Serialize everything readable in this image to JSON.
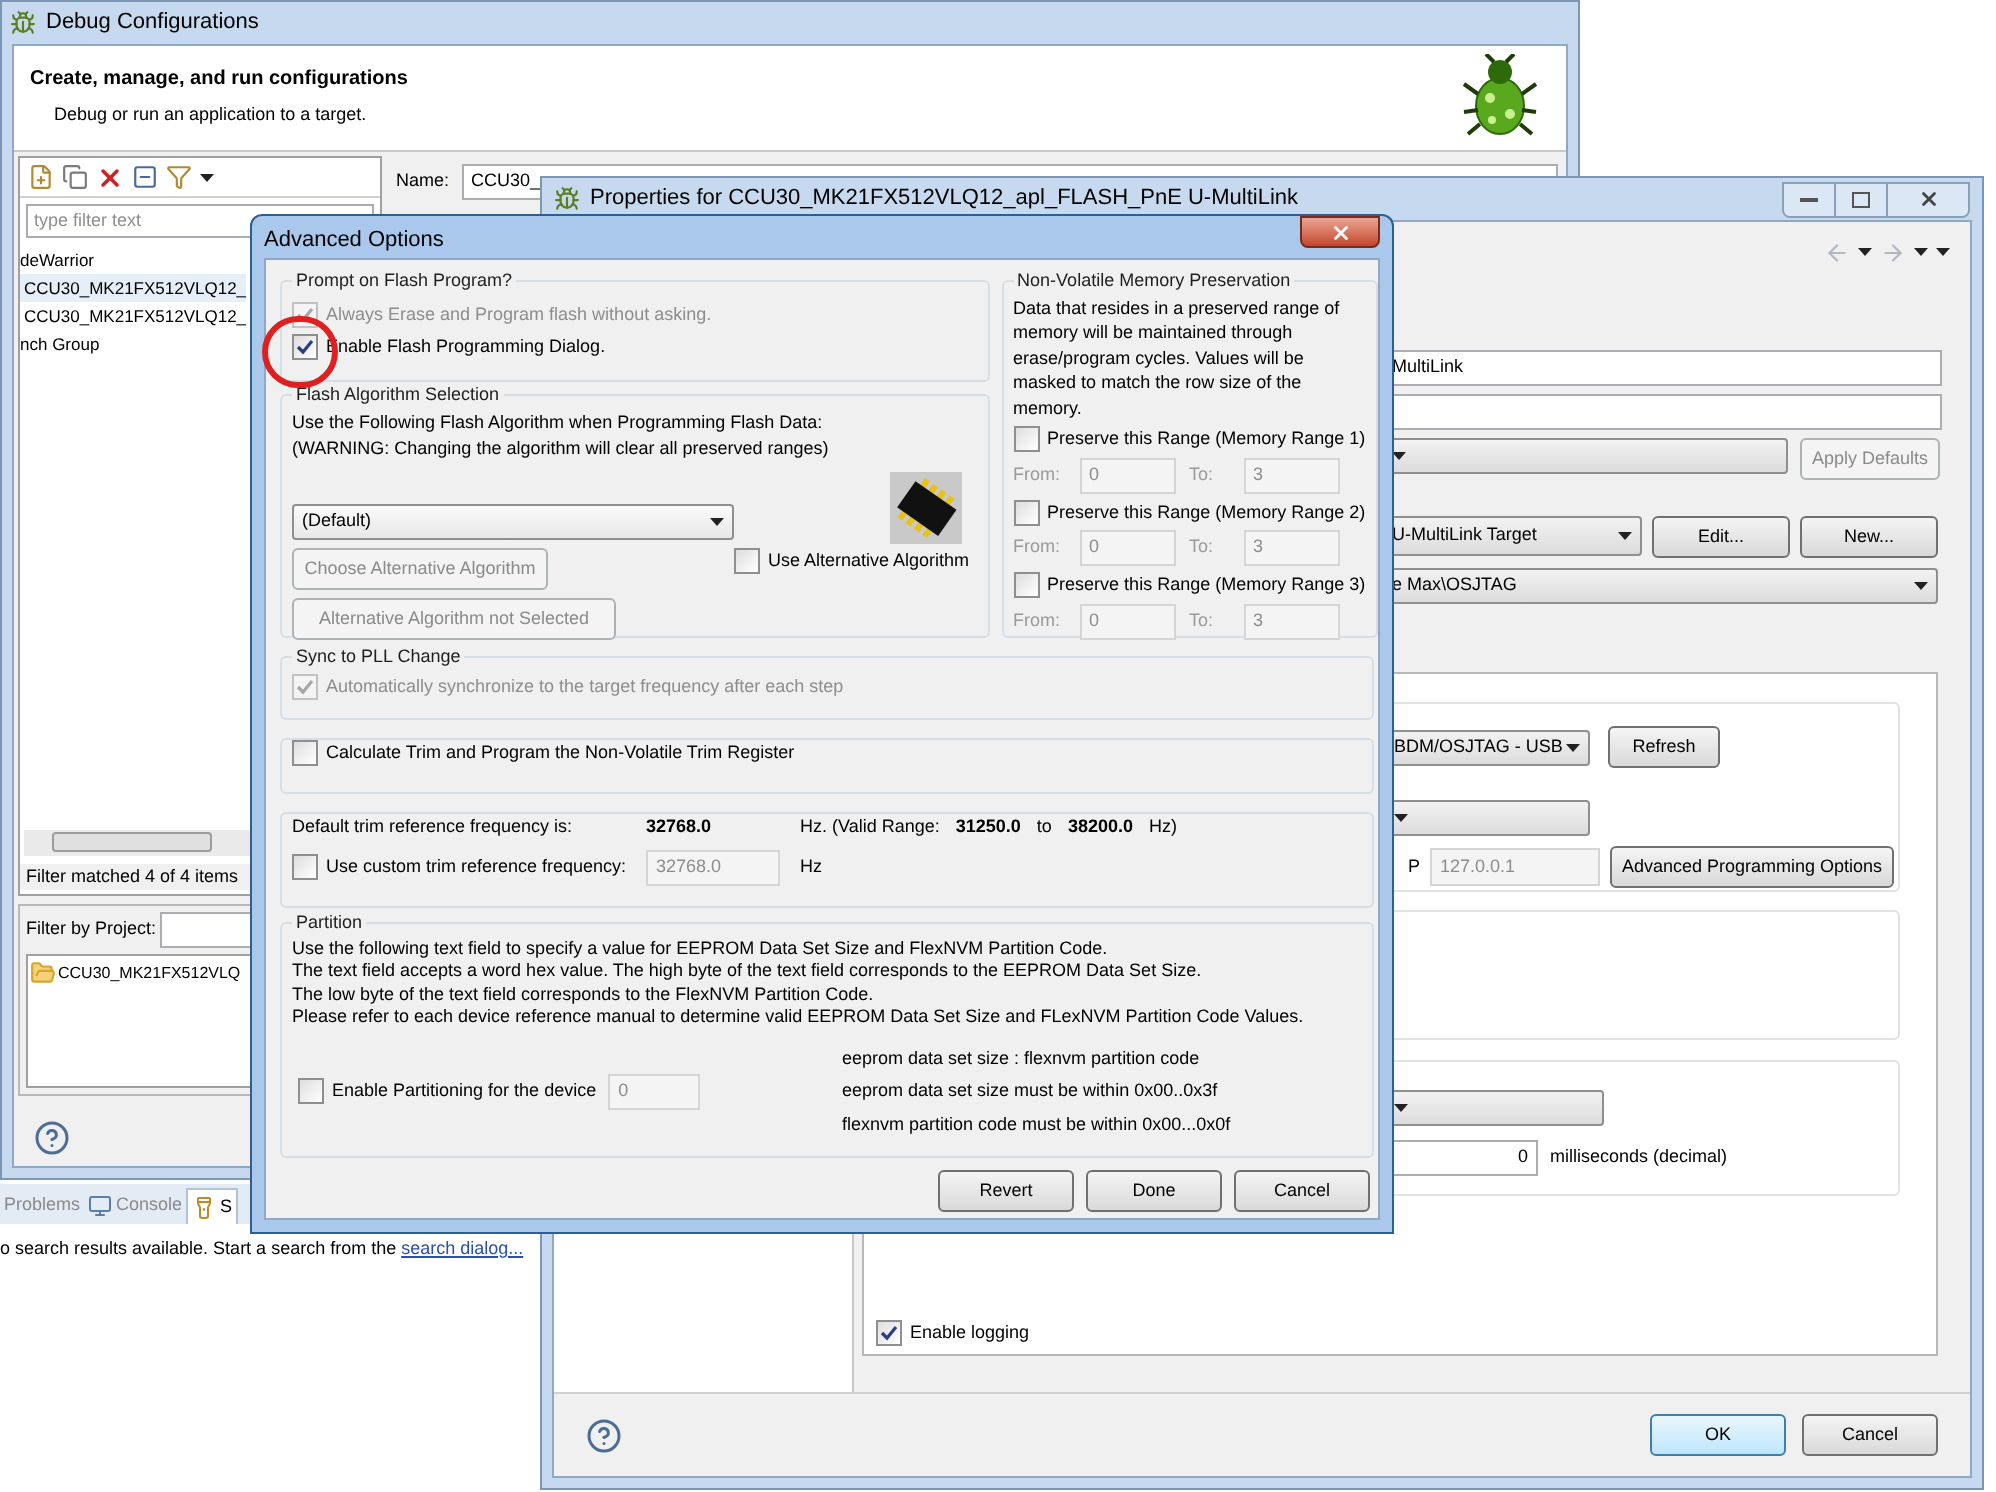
{
  "workbench": {
    "tabs": [
      {
        "label": "Problems",
        "selected": false
      },
      {
        "label": "Console",
        "selected": false
      },
      {
        "label": "S",
        "selected": true
      }
    ],
    "message": "o search results available. Start a search from the ",
    "link": "search dialog..."
  },
  "debug_window": {
    "title": "Debug Configurations",
    "heading": "Create, manage, and run configurations",
    "subheading": "Debug or run an application to a target.",
    "filter": {
      "placeholder": "type filter text"
    },
    "tree": [
      {
        "label": "deWarrior",
        "selected": false,
        "children": [
          {
            "label": "CCU30_MK21FX512VLQ12_",
            "selected": true
          },
          {
            "label": "CCU30_MK21FX512VLQ12_",
            "selected": false
          }
        ]
      },
      {
        "label": "nch Group",
        "selected": false
      }
    ],
    "filter_status": "Filter matched 4 of 4 items",
    "project_filter": {
      "label": "Filter by Project:"
    },
    "projects": [
      "CCU30_MK21FX512VLQ"
    ],
    "name": {
      "label": "Name:",
      "value": "CCU30_"
    }
  },
  "properties_window": {
    "title": "Properties for CCU30_MK21FX512VLQ12_apl_FLASH_PnE U-MultiLink",
    "name_value": "MultiLink",
    "apply_button": {
      "label": "Apply Defaults",
      "disabled": true
    },
    "target": {
      "value": "U-MultiLink Target",
      "buttons": [
        "Edit...",
        "New..."
      ]
    },
    "interface": "e Max\\OSJTAG",
    "port": "BDM/OSJTAG - USB",
    "refresh": "Refresh",
    "ip": {
      "label": "P",
      "value": "127.0.0.1",
      "disabled": true
    },
    "advanced_button": "Advanced Programming Options",
    "delay": {
      "value": "0",
      "unit": "milliseconds (decimal)"
    },
    "logging": {
      "label": "Enable logging",
      "checked": true
    },
    "buttons": [
      {
        "label": "OK",
        "default": true
      },
      {
        "label": "Cancel",
        "default": false
      }
    ]
  },
  "advanced_options": {
    "title": "Advanced Options",
    "prompt": {
      "title": "Prompt on Flash Program?",
      "options": [
        {
          "label": "Always Erase and Program flash without asking.",
          "checked": true,
          "disabled": true
        },
        {
          "label": "Enable Flash Programming Dialog.",
          "checked": true,
          "disabled": false
        }
      ]
    },
    "algorithm": {
      "title": "Flash Algorithm Selection",
      "description": [
        "Use the Following Flash Algorithm when Programming Flash Data:",
        "(WARNING: Changing the algorithm will clear all preserved ranges)"
      ],
      "select": "(Default)",
      "choose_button": {
        "label": "Choose Alternative Algorithm",
        "disabled": true
      },
      "status_button": {
        "label": "Alternative Algorithm not Selected",
        "disabled": true
      },
      "use_alternative": {
        "label": "Use Alternative Algorithm",
        "checked": false
      }
    },
    "nvm": {
      "title": "Non-Volatile Memory Preservation",
      "description": "Data that resides in a preserved range of memory will be maintained through erase/program cycles. Values will be masked to match the row size of the memory.",
      "ranges": [
        {
          "label": "Preserve this Range (Memory Range 1)",
          "checked": false,
          "from_label": "From:",
          "from": "0",
          "to_label": "To:",
          "to": "3"
        },
        {
          "label": "Preserve this Range (Memory Range 2)",
          "checked": false,
          "from_label": "From:",
          "from": "0",
          "to_label": "To:",
          "to": "3"
        },
        {
          "label": "Preserve this Range (Memory Range 3)",
          "checked": false,
          "from_label": "From:",
          "from": "0",
          "to_label": "To:",
          "to": "3"
        }
      ]
    },
    "sync": {
      "title": "Sync to PLL Change",
      "option": {
        "label": "Automatically synchronize to the target frequency after each step",
        "checked": true,
        "disabled": true
      }
    },
    "trim": {
      "label": "Calculate Trim and Program the Non-Volatile Trim Register",
      "checked": false
    },
    "frequency": {
      "default_label": "Default trim reference frequency is:",
      "default_value": "32768.0",
      "range_prefix": "Hz. (Valid Range:",
      "range_min": "31250.0",
      "range_to": "to",
      "range_max": "38200.0",
      "range_suffix": "Hz)",
      "custom": {
        "label": "Use custom trim reference frequency:",
        "checked": false,
        "value": "32768.0",
        "unit": "Hz"
      }
    },
    "partition": {
      "title": "Partition",
      "lines": [
        "Use the following text field to specify a value for EEPROM Data Set Size and FlexNVM Partition Code.",
        "The text field accepts a word hex value. The high byte of the text field corresponds to the EEPROM Data Set Size.",
        "The low byte of the text field corresponds to the FlexNVM Partition Code.",
        "Please refer to each device reference manual to determine valid EEPROM Data Set Size and FLexNVM Partition Code Values."
      ],
      "enable": {
        "label": "Enable Partitioning for the device",
        "checked": false,
        "value": "0"
      },
      "notes": [
        "eeprom data set size : flexnvm partition code",
        "eeprom data set size must be within 0x00..0x3f",
        "flexnvm partition code must be within 0x00...0x0f"
      ]
    },
    "buttons": [
      "Revert",
      "Done",
      "Cancel"
    ]
  }
}
